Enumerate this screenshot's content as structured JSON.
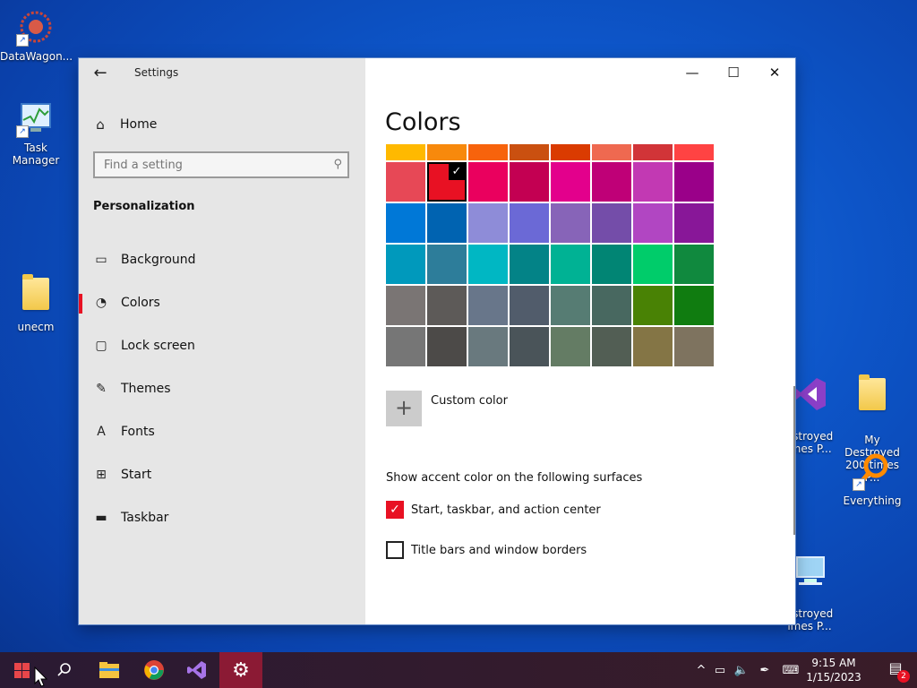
{
  "desktop": {
    "icons": [
      {
        "label": "DataWagon...",
        "icon": "datawagon-icon"
      },
      {
        "label": "Task Manager",
        "icon": "task-manager-icon"
      },
      {
        "label": "unecm",
        "icon": "folder-icon"
      },
      {
        "label": "estroyed\nimes P...",
        "icon": "visual-studio-icon"
      },
      {
        "label": "My Destroyed\n200 times P...",
        "icon": "folder-icon"
      },
      {
        "label": "Everything",
        "icon": "magnifier-icon"
      },
      {
        "label": "estroyed\nimes P...",
        "icon": "computer-icon"
      }
    ]
  },
  "window": {
    "title": "Settings",
    "controls": {
      "minimize": "—",
      "maximize": "☐",
      "close": "✕"
    }
  },
  "nav": {
    "home": "Home",
    "search_placeholder": "Find a setting",
    "section": "Personalization",
    "items": [
      {
        "label": "Background",
        "icon": "image-icon"
      },
      {
        "label": "Colors",
        "icon": "palette-icon",
        "active": true
      },
      {
        "label": "Lock screen",
        "icon": "lock-screen-icon"
      },
      {
        "label": "Themes",
        "icon": "themes-icon"
      },
      {
        "label": "Fonts",
        "icon": "fonts-icon"
      },
      {
        "label": "Start",
        "icon": "start-icon"
      },
      {
        "label": "Taskbar",
        "icon": "taskbar-icon"
      }
    ]
  },
  "content": {
    "heading": "Colors",
    "top_row_colors": [
      "#ffb900",
      "#f7890c",
      "#f7630c",
      "#ca5010",
      "#da3b01",
      "#ef6950",
      "#d13438",
      "#ff4343"
    ],
    "color_rows": [
      [
        "#e74856",
        "#e81123",
        "#ea005e",
        "#c30052",
        "#e3008c",
        "#bf0077",
        "#c239b3",
        "#9a0089"
      ],
      [
        "#0078d7",
        "#0063b1",
        "#8e8cd8",
        "#6b69d6",
        "#8764b8",
        "#744da9",
        "#b146c2",
        "#881798"
      ],
      [
        "#0099bc",
        "#2d7d9a",
        "#00b7c3",
        "#038387",
        "#00b294",
        "#018574",
        "#00cc6a",
        "#10893e"
      ],
      [
        "#7a7574",
        "#5d5a58",
        "#68768a",
        "#515c6b",
        "#567c73",
        "#486860",
        "#498205",
        "#107c10"
      ],
      [
        "#767676",
        "#4c4a48",
        "#69797e",
        "#4a5459",
        "#647c64",
        "#525e54",
        "#847545",
        "#7e735f"
      ]
    ],
    "selected": {
      "row": 0,
      "col": 1
    },
    "custom_color": "Custom color",
    "surfaces_heading": "Show accent color on the following surfaces",
    "checkbox_taskbar": "Start, taskbar, and action center",
    "checkbox_taskbar_checked": true,
    "checkbox_titlebars": "Title bars and window borders",
    "checkbox_titlebars_checked": false
  },
  "taskbar": {
    "clock_time": "9:15 AM",
    "clock_date": "1/15/2023",
    "notification_count": "2"
  }
}
